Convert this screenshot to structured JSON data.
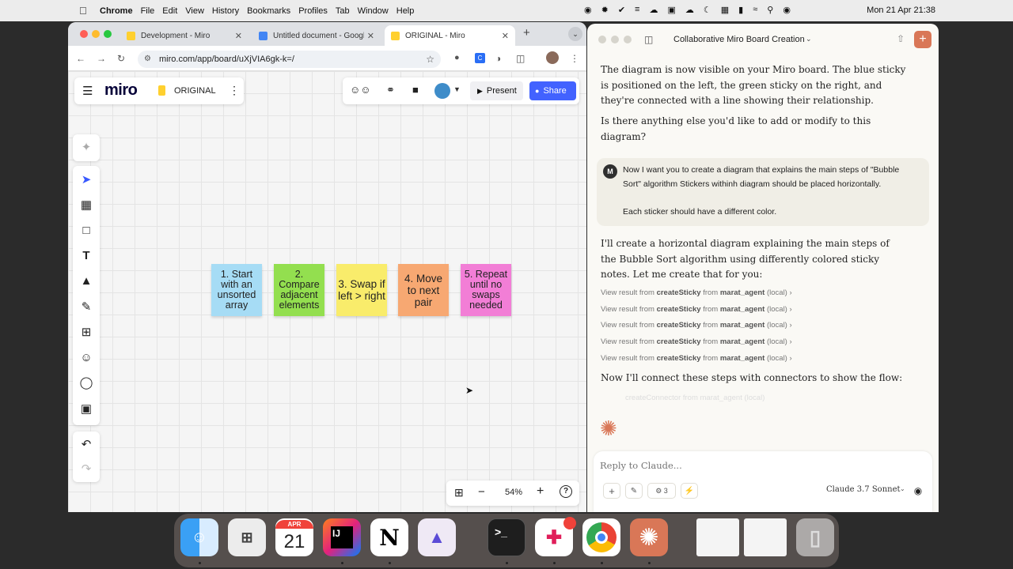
{
  "menubar": {
    "app": "Chrome",
    "items": [
      "File",
      "Edit",
      "View",
      "History",
      "Bookmarks",
      "Profiles",
      "Tab",
      "Window",
      "Help"
    ],
    "clock": "Mon 21 Apr  21:38"
  },
  "browser": {
    "tabs": [
      {
        "title": "Development - Miro",
        "active": false
      },
      {
        "title": "Untitled document - Google",
        "active": false
      },
      {
        "title": "ORIGINAL - Miro",
        "active": true
      }
    ],
    "url": "miro.com/app/board/uXjVIA6gk-k=/",
    "new_tab": "+"
  },
  "miro": {
    "logo": "miro",
    "board_name": "ORIGINAL",
    "present_label": "Present",
    "share_label": "Share",
    "zoom": "54%",
    "stickies": [
      {
        "text": "1. Start with an unsorted array",
        "color": "#a6dcf5"
      },
      {
        "text": "2. Compare adjacent elements",
        "color": "#93df4f"
      },
      {
        "text": "3. Swap if left > right",
        "color": "#f9ec6b"
      },
      {
        "text": "4. Move to next pair",
        "color": "#f7a872"
      },
      {
        "text": "5. Repeat until no swaps needed",
        "color": "#f27ed6"
      }
    ]
  },
  "claude": {
    "title": "Collaborative Miro Board Creation",
    "msg1": "The diagram is now visible on your Miro board. The blue sticky is positioned on the left, the green sticky on the right, and they're connected with a line showing their relationship.",
    "msg2": "Is there anything else you'd like to add or modify to this diagram?",
    "user_avatar": "M",
    "user_msg_1": "Now I want you to create a diagram that explains the main steps of \"Bubble Sort\" algorithm Stickers withinh diagram should be placed horizontally.",
    "user_msg_2": "Each sticker should have a different color.",
    "msg3": "I'll create a horizontal diagram explaining the main steps of the Bubble Sort algorithm using differently colored sticky notes. Let me create that for you:",
    "tool_results": [
      {
        "prefix": "View result from",
        "tool": "createSticky",
        "mid": "from",
        "agent": "marat_agent",
        "suffix": "(local)"
      },
      {
        "prefix": "View result from",
        "tool": "createSticky",
        "mid": "from",
        "agent": "marat_agent",
        "suffix": "(local)"
      },
      {
        "prefix": "View result from",
        "tool": "createSticky",
        "mid": "from",
        "agent": "marat_agent",
        "suffix": "(local)"
      },
      {
        "prefix": "View result from",
        "tool": "createSticky",
        "mid": "from",
        "agent": "marat_agent",
        "suffix": "(local)"
      },
      {
        "prefix": "View result from",
        "tool": "createSticky",
        "mid": "from",
        "agent": "marat_agent",
        "suffix": "(local)"
      }
    ],
    "msg4": "Now I'll connect these steps with connectors to show the flow:",
    "faded": "createConnector from marat_agent (local)",
    "reply_placeholder": "Reply to Claude...",
    "tools_count": "3",
    "model": "Claude 3.7 Sonnet"
  },
  "dock": {
    "calendar_month": "APR",
    "calendar_day": "21",
    "notion_letter": "N",
    "ij_letters": "IJ",
    "terminal_prompt": ">_"
  },
  "colors": {
    "miro_blue": "#4262ff",
    "claude_accent": "#d97757"
  }
}
